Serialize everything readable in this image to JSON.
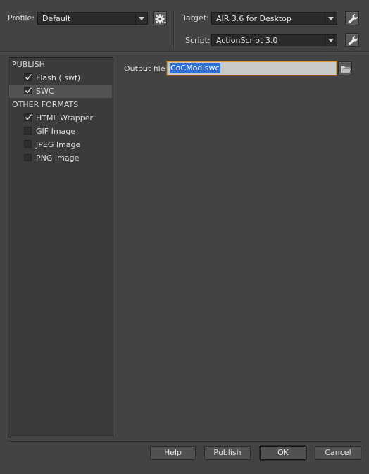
{
  "header": {
    "profile_label": "Profile:",
    "profile_value": "Default",
    "target_label": "Target:",
    "target_value": "AIR 3.6 for Desktop",
    "script_label": "Script:",
    "script_value": "ActionScript 3.0"
  },
  "sidebar": {
    "publish_heading": "PUBLISH",
    "publish_items": [
      {
        "label": "Flash (.swf)",
        "checked": true
      },
      {
        "label": "SWC",
        "checked": true
      }
    ],
    "other_heading": "OTHER FORMATS",
    "other_items": [
      {
        "label": "HTML Wrapper",
        "checked": true
      },
      {
        "label": "GIF Image",
        "checked": false
      },
      {
        "label": "JPEG Image",
        "checked": false
      },
      {
        "label": "PNG Image",
        "checked": false
      }
    ]
  },
  "main": {
    "output_label": "Output file:",
    "output_value": "CoCMod.swc"
  },
  "footer": {
    "help": "Help",
    "publish": "Publish",
    "ok": "OK",
    "cancel": "Cancel"
  },
  "icons": {
    "profile_options": "gear-icon",
    "target_settings": "wrench-icon",
    "script_settings": "wrench-icon",
    "browse": "folder-icon"
  }
}
